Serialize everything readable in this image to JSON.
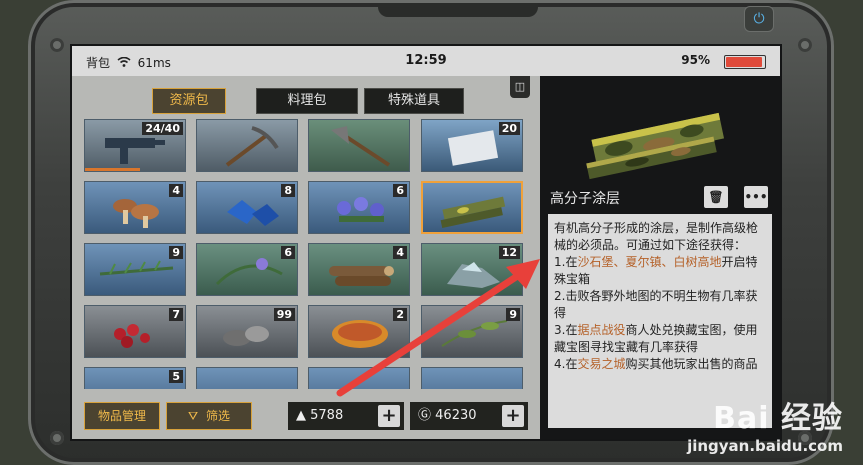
{
  "status": {
    "left_label": "背包",
    "ping": "61ms",
    "time": "12:59",
    "battery_pct": "95%",
    "battery_level": 0.95,
    "battery_color": "#e04a3a"
  },
  "tabs": [
    {
      "label": "资源包",
      "active": true
    },
    {
      "label": "料理包",
      "active": false
    },
    {
      "label": "特殊道具",
      "active": false
    }
  ],
  "pin_icon": "pin-icon",
  "grid": {
    "rows": [
      [
        {
          "item": "submachine-gun",
          "count": "24/40",
          "progress": 0.55
        },
        {
          "item": "pickaxe",
          "count": ""
        },
        {
          "item": "axe",
          "count": ""
        },
        {
          "item": "sealed-package",
          "count": "20"
        }
      ],
      [
        {
          "item": "mushrooms",
          "count": "4"
        },
        {
          "item": "blue-crystals",
          "count": "8"
        },
        {
          "item": "purple-flowers",
          "count": "6"
        },
        {
          "item": "camo-coating",
          "count": "",
          "selected": true
        }
      ],
      [
        {
          "item": "pine-sprig",
          "count": "9"
        },
        {
          "item": "herb-flower",
          "count": "6"
        },
        {
          "item": "wood-logs",
          "count": "4"
        },
        {
          "item": "ore-chunks",
          "count": "12"
        }
      ],
      [
        {
          "item": "red-berries",
          "count": "7"
        },
        {
          "item": "stones",
          "count": "99"
        },
        {
          "item": "canned-food",
          "count": "2"
        },
        {
          "item": "leaf-branch",
          "count": "9"
        }
      ],
      [
        {
          "item": "partial",
          "count": "5"
        },
        {
          "item": "partial",
          "count": ""
        },
        {
          "item": "partial",
          "count": ""
        },
        {
          "item": "partial",
          "count": ""
        }
      ]
    ]
  },
  "bottom": {
    "manage_label": "物品管理",
    "filter_label": "筛选",
    "currency1": "5788",
    "currency2": "46230"
  },
  "detail": {
    "name": "高分子涂层",
    "desc_intro": "有机高分子形成的涂层，是制作高级枪械的必须品。可通过如下途径获得：",
    "line1_prefix": "1.在",
    "line1_places": "沙石堡、夏尔镇、白树高地",
    "line1_suffix": "开启特殊宝箱",
    "line2": "2.击败各野外地图的不明生物有几率获得",
    "line3_prefix": "3.在",
    "line3_place": "据点战役",
    "line3_suffix": "商人处兑换藏宝图，使用藏宝图寻找宝藏有几率获得",
    "line4_prefix": "4.在",
    "line4_place": "交易之城",
    "line4_suffix": "购买其他玩家出售的商品",
    "delete_icon": "trash-icon",
    "more_icon": "more-icon",
    "more_label": "•••"
  },
  "watermark": {
    "logo": "Bai 经验",
    "url": "jingyan.baidu.com"
  }
}
